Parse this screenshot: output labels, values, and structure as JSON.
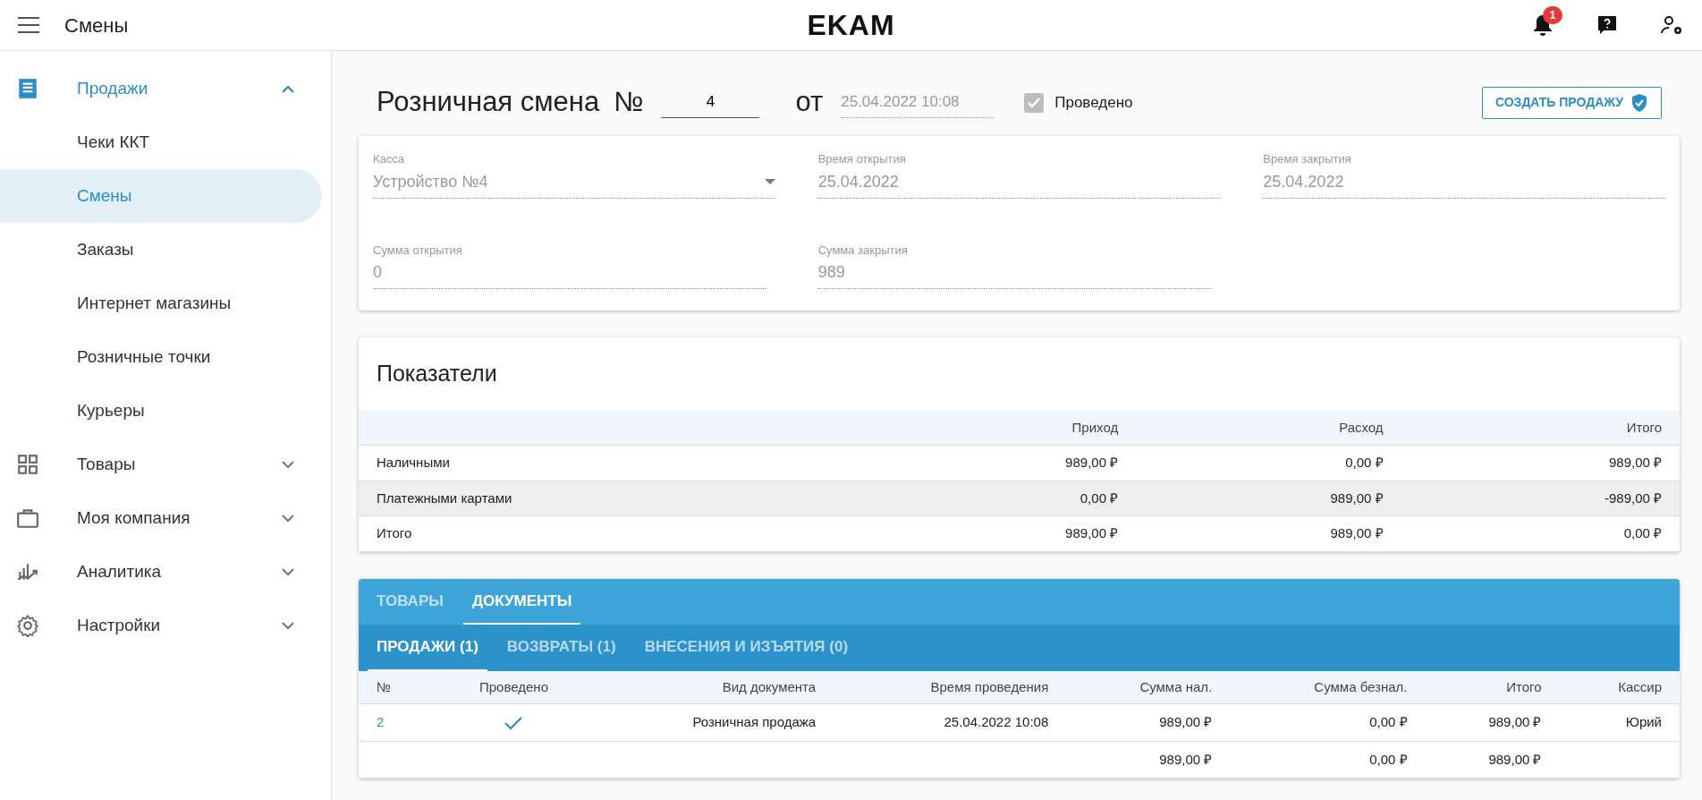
{
  "header": {
    "title": "Смены",
    "logo": "EKAM",
    "notification_count": "1"
  },
  "sidebar": {
    "items": [
      {
        "label": "Продажи",
        "kind": "receipt",
        "expanded": true,
        "children": [
          {
            "label": "Чеки ККТ",
            "selected": false
          },
          {
            "label": "Смены",
            "selected": true
          },
          {
            "label": "Заказы",
            "selected": false
          },
          {
            "label": "Интернет магазины",
            "selected": false
          },
          {
            "label": "Розничные точки",
            "selected": false
          },
          {
            "label": "Курьеры",
            "selected": false
          }
        ]
      },
      {
        "label": "Товары",
        "kind": "grid",
        "expanded": false
      },
      {
        "label": "Моя компания",
        "kind": "briefcase",
        "expanded": false
      },
      {
        "label": "Аналитика",
        "kind": "chart",
        "expanded": false
      },
      {
        "label": "Настройки",
        "kind": "gear",
        "expanded": false
      }
    ]
  },
  "shift": {
    "title": "Розничная смена",
    "number_label": "№",
    "number": "4",
    "from_label": "от",
    "date": "25.04.2022 10:08",
    "posted": {
      "label": "Проведено",
      "checked": true
    },
    "create_button": "СОЗДАТЬ ПРОДАЖУ"
  },
  "fields": [
    [
      {
        "label": "Касса",
        "value": "Устройство №4",
        "kind": "select"
      },
      {
        "label": "Время открытия",
        "value": "25.04.2022",
        "kind": "text"
      },
      {
        "label": "Время закрытия",
        "value": "25.04.2022",
        "kind": "text"
      }
    ],
    [
      {
        "label": "Сумма открытия",
        "value": "0",
        "kind": "text"
      },
      {
        "label": "Сумма закрытия",
        "value": "989",
        "kind": "text"
      }
    ]
  ],
  "indicators": {
    "title": "Показатели",
    "columns": [
      "",
      "Приход",
      "Расход",
      "Итого"
    ],
    "rows": [
      {
        "cells": [
          "Наличными",
          "989,00 ₽",
          "0,00 ₽",
          "989,00 ₽"
        ],
        "highlighted": false
      },
      {
        "cells": [
          "Платежными картами",
          "0,00 ₽",
          "989,00 ₽",
          "-989,00 ₽"
        ],
        "highlighted": true
      },
      {
        "cells": [
          "Итого",
          "989,00 ₽",
          "989,00 ₽",
          "0,00 ₽"
        ],
        "highlighted": false
      }
    ]
  },
  "tabs": [
    {
      "label": "ТОВАРЫ",
      "selected": false
    },
    {
      "label": "ДОКУМЕНТЫ",
      "selected": true
    }
  ],
  "subtabs": [
    {
      "label": "ПРОДАЖИ (1)",
      "selected": true
    },
    {
      "label": "ВОЗВРАТЫ (1)",
      "selected": false
    },
    {
      "label": "ВНЕСЕНИЯ И ИЗЪЯТИЯ (0)",
      "selected": false
    }
  ],
  "documents": {
    "columns": [
      "№",
      "Проведено",
      "Вид документа",
      "Время проведения",
      "Сумма нал.",
      "Сумма безнал.",
      "Итого",
      "Кассир"
    ],
    "rows": [
      {
        "number": "2",
        "posted": true,
        "type": "Розничная продажа",
        "time": "25.04.2022 10:08",
        "cash": "989,00 ₽",
        "cashless": "0,00 ₽",
        "total": "989,00 ₽",
        "cashier": "Юрий"
      }
    ],
    "totals": {
      "cash": "989,00 ₽",
      "cashless": "0,00 ₽",
      "total": "989,00 ₽"
    }
  }
}
